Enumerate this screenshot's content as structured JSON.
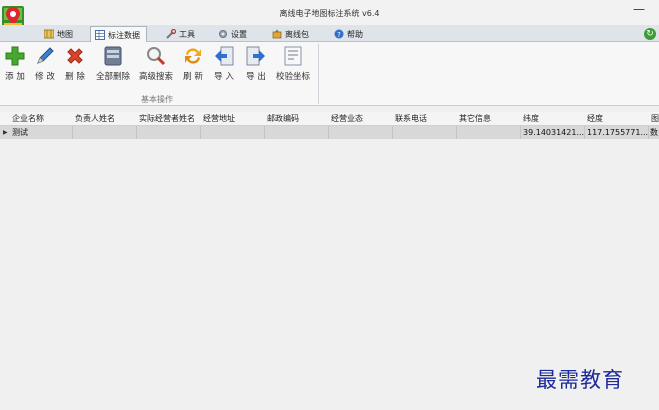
{
  "window": {
    "title": "离线电子地图标注系统 v6.4",
    "minimize_glyph": "—"
  },
  "tabs": [
    {
      "label": "地图",
      "icon": "map-icon"
    },
    {
      "label": "标注数据",
      "icon": "table-icon",
      "active": true
    },
    {
      "label": "工具",
      "icon": "tools-icon"
    },
    {
      "label": "设置",
      "icon": "settings-icon"
    },
    {
      "label": "离线包",
      "icon": "package-icon"
    },
    {
      "label": "帮助",
      "icon": "help-icon"
    }
  ],
  "ribbon": {
    "buttons": [
      {
        "label": "添 加",
        "icon": "add-icon"
      },
      {
        "label": "修 改",
        "icon": "edit-icon"
      },
      {
        "label": "删 除",
        "icon": "delete-icon"
      },
      {
        "label": "全部删除",
        "icon": "delete-all-icon"
      },
      {
        "label": "高级搜索",
        "icon": "advanced-search-icon"
      },
      {
        "label": "刷 新",
        "icon": "refresh-icon"
      },
      {
        "label": "导 入",
        "icon": "import-icon"
      },
      {
        "label": "导 出",
        "icon": "export-icon"
      },
      {
        "label": "校验坐标",
        "icon": "verify-coordinates-icon"
      }
    ],
    "group_label": "基本操作"
  },
  "grid": {
    "columns": [
      "企业名称",
      "负责人姓名",
      "实际经营者姓名",
      "经营地址",
      "邮政编码",
      "经营业态",
      "联系电话",
      "其它信息",
      "纬度",
      "经度",
      "图"
    ],
    "rows": [
      {
        "cells": [
          "测试",
          "",
          "",
          "",
          "",
          "",
          "",
          "",
          "39.14031421...",
          "117.1755771...",
          "数"
        ]
      }
    ]
  },
  "watermark": "最需教育",
  "colors": {
    "accent_green": "#3a9d3a",
    "delete_red": "#d9442b",
    "watermark_blue": "#1d2a9a"
  }
}
